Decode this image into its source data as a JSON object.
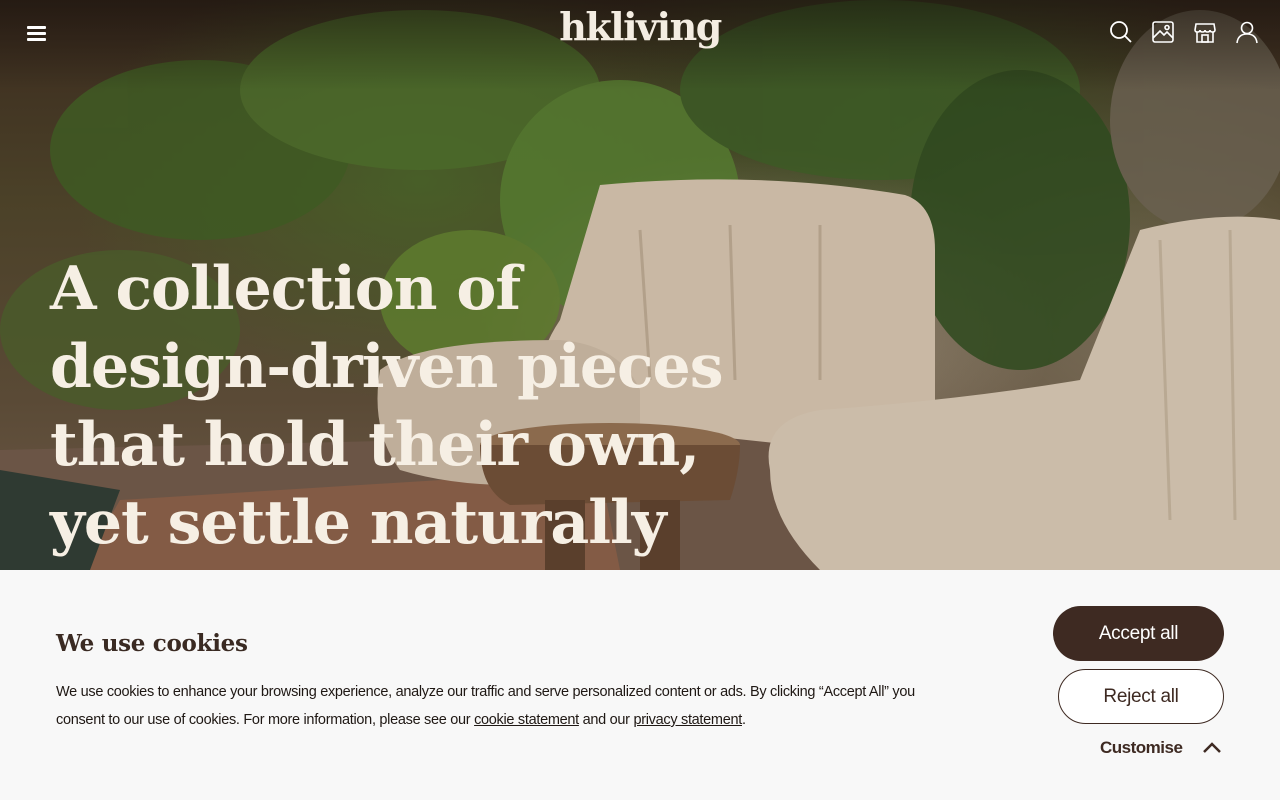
{
  "header": {
    "brand": "hkliving",
    "menu_icon": "hamburger-menu-icon",
    "icons": [
      "search-icon",
      "image-gallery-icon",
      "store-icon",
      "account-icon"
    ]
  },
  "hero": {
    "headline": "A collection of\ndesign-driven pieces\nthat hold their own,\nyet settle naturally"
  },
  "cookie_banner": {
    "title": "We use cookies",
    "text_before": "We use cookies to enhance your browsing experience, analyze our traffic and serve personalized content or ads. By clicking “Accept All” you consent to our use of cookies. For more information, please see our ",
    "cookie_link": "cookie statement",
    "text_middle": " and our ",
    "privacy_link": "privacy statement",
    "text_after": ".",
    "accept_label": "Accept all",
    "reject_label": "Reject all",
    "customise_label": "Customise"
  },
  "colors": {
    "brand_dark": "#3e2a22",
    "banner_bg": "#f8f8f8",
    "hero_text": "#f6efe4"
  }
}
